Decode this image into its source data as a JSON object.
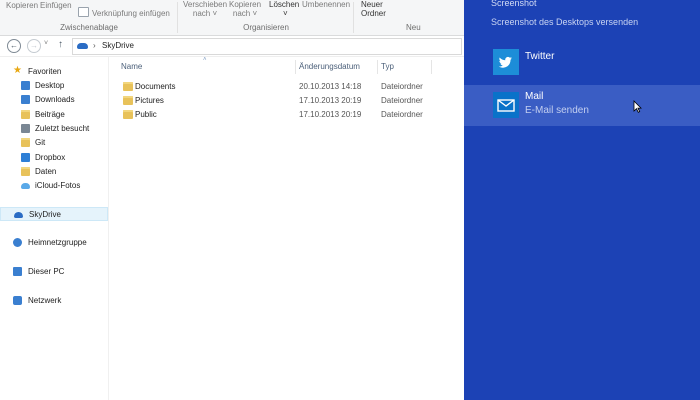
{
  "ribbon": {
    "kopieren": "Kopieren",
    "einfuegen": "Einfügen",
    "verknuepfung": "Verknüpfung einfügen",
    "zwischenablage": "Zwischenablage",
    "verschieben": "Verschieben",
    "verschieben_nach": "nach",
    "kopieren2": "Kopieren",
    "kopieren_nach": "nach",
    "loeschen": "Löschen",
    "umbenennen": "Umbenennen",
    "organisieren": "Organisieren",
    "neuer": "Neuer",
    "ordner": "Ordner",
    "neu": "Neu"
  },
  "address": {
    "back": "←",
    "forward": "→",
    "up": "↑",
    "chevron": "›",
    "location": "SkyDrive"
  },
  "nav": {
    "favoriten": "Favoriten",
    "desktop": "Desktop",
    "downloads": "Downloads",
    "beitraege": "Beiträge",
    "zuletzt": "Zuletzt besucht",
    "git": "Git",
    "dropbox": "Dropbox",
    "daten": "Daten",
    "icloud": "iCloud-Fotos",
    "skydrive": "SkyDrive",
    "heimnetz": "Heimnetzgruppe",
    "dieserpc": "Dieser PC",
    "netzwerk": "Netzwerk"
  },
  "columns": {
    "name": "Name",
    "date": "Änderungsdatum",
    "type": "Typ"
  },
  "files": [
    {
      "name": "Documents",
      "date": "20.10.2013 14:18",
      "type": "Dateiordner"
    },
    {
      "name": "Pictures",
      "date": "17.10.2013 20:19",
      "type": "Dateiordner"
    },
    {
      "name": "Public",
      "date": "17.10.2013 20:19",
      "type": "Dateiordner"
    }
  ],
  "charm": {
    "title": "Screenshot",
    "subtitle": "Screenshot des Desktops versenden",
    "apps": [
      {
        "name": "Twitter",
        "desc": ""
      },
      {
        "name": "Mail",
        "desc": "E-Mail senden"
      }
    ]
  },
  "colors": {
    "charm_bg": "#1c42b5",
    "charm_hover": "#3a5dc4",
    "twitter": "#1d8dd8",
    "mail": "#0a72c9",
    "selection": "#e5f3fb"
  }
}
